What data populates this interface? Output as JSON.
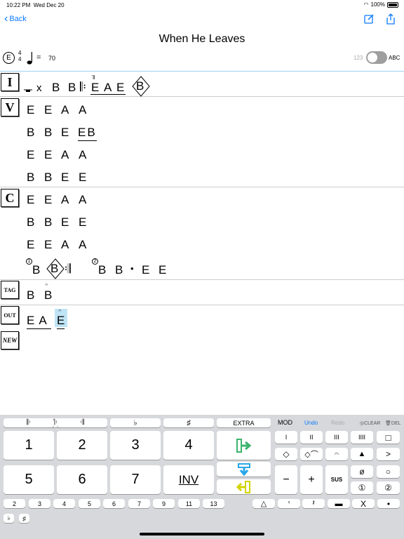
{
  "status": {
    "time": "10:22 PM",
    "date": "Wed Dec 20",
    "battery": "100%"
  },
  "nav": {
    "back_label": "Back",
    "title": "When He Leaves",
    "icons": [
      "compose-icon",
      "share-icon"
    ]
  },
  "meta": {
    "key": "E",
    "time_top": "4",
    "time_bottom": "4",
    "eq": "=",
    "tempo": "70",
    "toggle_left": "123",
    "toggle_right": "ABC"
  },
  "sections": {
    "intro": "I",
    "verse": "V",
    "chorus": "C",
    "tag": "TAG",
    "outro": "OUT",
    "new": "NEW"
  },
  "chart": {
    "intro": {
      "x": "x",
      "b1": "B",
      "b2": "B",
      "e1": "E",
      "a": "A",
      "e2": "E",
      "bd": "B"
    },
    "verse": [
      [
        "E",
        "E",
        "A",
        "A"
      ],
      [
        "B",
        "B",
        "E",
        "EB"
      ],
      [
        "E",
        "E",
        "A",
        "A"
      ],
      [
        "B",
        "B",
        "E",
        "E"
      ]
    ],
    "chorus": [
      [
        "E",
        "E",
        "A",
        "A"
      ],
      [
        "B",
        "B",
        "E",
        "E"
      ],
      [
        "E",
        "E",
        "A",
        "A"
      ]
    ],
    "chorus_end": {
      "n1": "1",
      "b1": "B",
      "bd": "B",
      "n2": "2",
      "b2": "B",
      "b3": "B",
      "dot": "•",
      "e1": "E",
      "e2": "E"
    },
    "tag": [
      "B",
      "B"
    ],
    "outro": [
      "EA",
      "E"
    ]
  },
  "keyboard": {
    "top_row": [
      "𝄆",
      "𝄇",
      "♭",
      "♯",
      "EXTRA"
    ],
    "mod": "MOD",
    "undo": "Undo",
    "redo": "Redo",
    "clear": "CLEAR",
    "del": "DEL",
    "nums": [
      "1",
      "2",
      "3",
      "4",
      "5",
      "6",
      "7"
    ],
    "inv": "INV",
    "sym_row1": [
      "I",
      "II",
      "III",
      "IIII",
      "□"
    ],
    "sym_row2": [
      "◇",
      "◇⌒",
      "𝄐",
      "▲",
      ">"
    ],
    "sym_row3": [
      "−",
      "+",
      "SUS",
      "ø",
      "○"
    ],
    "sym_row4": [
      "①",
      "②"
    ],
    "ext_row": [
      "2",
      "3",
      "4",
      "5",
      "6",
      "7",
      "9",
      "11",
      "13"
    ],
    "bottom_syms": [
      "△",
      "𝄾",
      "𝄽",
      "▬",
      "X",
      "•"
    ],
    "acc": [
      "♭",
      "♯"
    ]
  }
}
